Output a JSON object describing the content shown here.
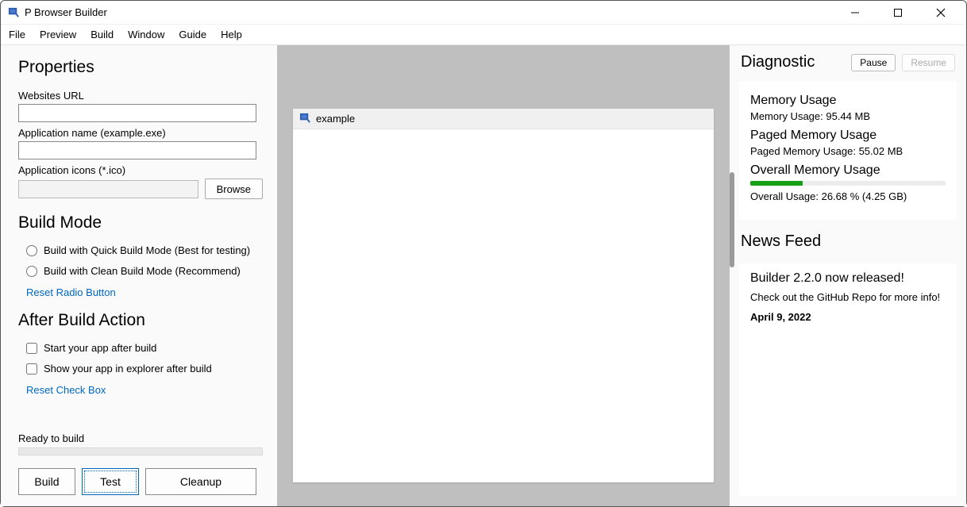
{
  "window": {
    "title": "P Browser Builder"
  },
  "menu": {
    "file": "File",
    "preview": "Preview",
    "build": "Build",
    "window": "Window",
    "guide": "Guide",
    "help": "Help"
  },
  "left": {
    "properties_heading": "Properties",
    "websites_url_label": "Websites URL",
    "websites_url_value": "",
    "appname_label": "Application name (example.exe)",
    "appname_value": "",
    "appicons_label": "Application icons (*.ico)",
    "appicons_value": "",
    "browse_label": "Browse",
    "buildmode_heading": "Build Mode",
    "radio_quick": "Build with Quick Build Mode (Best for testing)",
    "radio_clean": "Build with Clean Build Mode (Recommend)",
    "reset_radio": "Reset Radio Button",
    "afterbuild_heading": "After Build Action",
    "check_start": "Start your app after build",
    "check_show": "Show your app in explorer after build",
    "reset_check": "Reset Check Box",
    "status": "Ready to build",
    "btn_build": "Build",
    "btn_test": "Test",
    "btn_cleanup": "Cleanup"
  },
  "center": {
    "preview_title": "example"
  },
  "right": {
    "diag_heading": "Diagnostic",
    "pause": "Pause",
    "resume": "Resume",
    "mem_title": "Memory Usage",
    "mem_text": "Memory Usage: 95.44 MB",
    "paged_title": "Paged Memory Usage",
    "paged_text": "Paged Memory Usage: 55.02 MB",
    "overall_title": "Overall Memory Usage",
    "overall_text": "Overall Usage: 26.68 % (4.25 GB)",
    "overall_pct": "26.68",
    "news_heading": "News Feed",
    "news_title": "Builder 2.2.0 now released!",
    "news_body": "Check out the GitHub Repo for more info!",
    "news_date": "April 9, 2022"
  }
}
